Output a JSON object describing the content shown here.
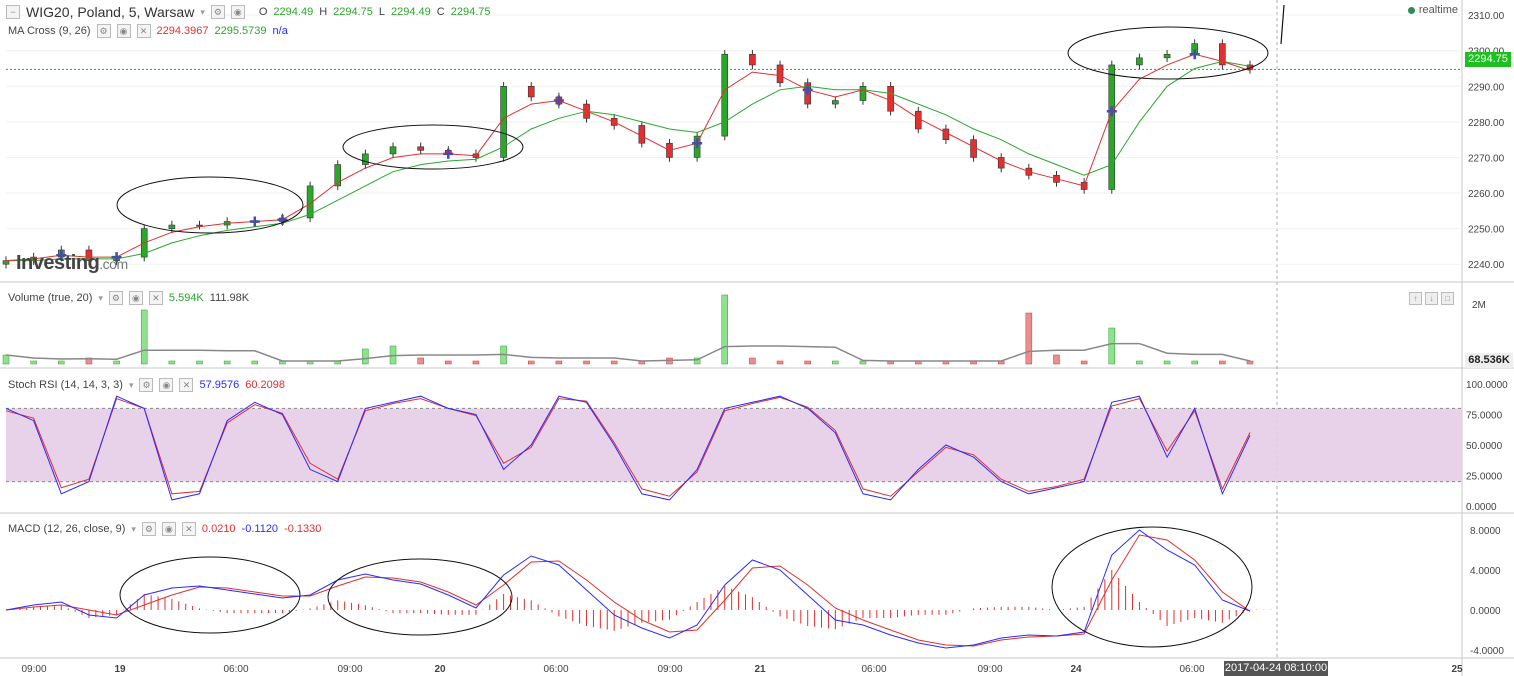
{
  "header": {
    "symbol": "WIG20, Poland, 5, Warsaw",
    "ohlc": {
      "o_label": "O",
      "o": "2294.49",
      "h_label": "H",
      "h": "2294.75",
      "l_label": "L",
      "l": "2294.49",
      "c_label": "C",
      "c": "2294.75"
    },
    "realtime": "realtime"
  },
  "indicators": {
    "ma": {
      "label": "MA Cross (9, 26)",
      "v1": "2294.3967",
      "v2": "2295.5739",
      "v3": "n/a"
    },
    "volume": {
      "label": "Volume (true, 20)",
      "v1": "5.594K",
      "v2": "111.98K"
    },
    "stoch": {
      "label": "Stoch RSI (14, 14, 3, 3)",
      "v1": "57.9576",
      "v2": "60.2098"
    },
    "macd": {
      "label": "MACD (12, 26, close, 9)",
      "v1": "0.0210",
      "v2": "-0.1120",
      "v3": "-0.1330"
    }
  },
  "logo": {
    "main": "Investing",
    "suffix": ".com"
  },
  "price_axis": {
    "ticks": [
      "2310.00",
      "2300.00",
      "2290.00",
      "2280.00",
      "2270.00",
      "2260.00",
      "2250.00",
      "2240.00"
    ],
    "current": "2294.75"
  },
  "volume_axis": {
    "ticks": [
      "2M"
    ],
    "current": "68.536K"
  },
  "stoch_axis": {
    "ticks": [
      "100.0000",
      "75.0000",
      "50.0000",
      "25.0000",
      "0.0000"
    ]
  },
  "macd_axis": {
    "ticks": [
      "8.0000",
      "4.0000",
      "0.0000",
      "-4.0000"
    ]
  },
  "time_axis": {
    "labels": [
      "09:00",
      "19",
      "06:00",
      "09:00",
      "20",
      "06:00",
      "09:00",
      "21",
      "06:00",
      "09:00",
      "24",
      "06:00",
      "25"
    ],
    "cursor": "2017-04-24 08:10:00"
  },
  "colors": {
    "up": "#2aa82a",
    "down": "#e03030",
    "ma_fast": "#e03030",
    "ma_slow": "#2aa82a",
    "stoch_k": "#2a2aff",
    "stoch_d": "#e03030",
    "macd": "#2a2aff",
    "signal": "#e03030",
    "band": "#e4cde8"
  },
  "chart_data": [
    {
      "type": "line",
      "title": "WIG20, Poland, 5, Warsaw",
      "note": "price (close) with MA Cross 9/26",
      "ylim": [
        2235,
        2312
      ],
      "series": [
        {
          "name": "close",
          "values": [
            2241,
            2242,
            2244,
            2241,
            2242,
            2250,
            2251,
            2251,
            2252,
            2252,
            2253,
            2262,
            2268,
            2271,
            2273,
            2272,
            2271,
            2270,
            2290,
            2287,
            2285,
            2281,
            2279,
            2274,
            2270,
            2276,
            2299,
            2296,
            2291,
            2285,
            2286,
            2290,
            2283,
            2278,
            2275,
            2270,
            2267,
            2265,
            2263,
            2261,
            2296,
            2298,
            2299,
            2302,
            2296,
            2294.75
          ]
        },
        {
          "name": "MA 9",
          "values": [
            2241,
            2241.5,
            2242.5,
            2242,
            2242,
            2246,
            2249,
            2250.5,
            2251.5,
            2252,
            2252.5,
            2257,
            2263,
            2267,
            2270,
            2271,
            2271,
            2270.5,
            2281,
            2285,
            2286,
            2283,
            2280,
            2276,
            2272,
            2274,
            2289,
            2294,
            2293,
            2289,
            2287,
            2289,
            2286,
            2281,
            2277,
            2273,
            2269,
            2266,
            2264,
            2262,
            2283,
            2292,
            2296,
            2299,
            2297,
            2294.4
          ]
        },
        {
          "name": "MA 26",
          "values": [
            2241,
            2241,
            2241.5,
            2241.5,
            2241.5,
            2243,
            2246,
            2248,
            2249.5,
            2250.5,
            2251.5,
            2254,
            2258,
            2262,
            2266,
            2268,
            2269,
            2269.5,
            2273,
            2278,
            2281,
            2283,
            2282,
            2280,
            2278,
            2277,
            2280,
            2285,
            2289,
            2290,
            2289,
            2289,
            2288,
            2285,
            2282,
            2278,
            2275,
            2271,
            2268,
            2265,
            2268,
            2280,
            2290,
            2295,
            2297,
            2295.6
          ]
        }
      ]
    },
    {
      "type": "bar",
      "title": "Volume (true, 20)",
      "values": [
        0.3,
        0.1,
        0.1,
        0.2,
        0.1,
        1.8,
        0.1,
        0.1,
        0.1,
        0.1,
        0.1,
        0.1,
        0.1,
        0.5,
        0.6,
        0.2,
        0.1,
        0.1,
        0.6,
        0.1,
        0.1,
        0.1,
        0.1,
        0.1,
        0.2,
        0.2,
        2.3,
        0.2,
        0.1,
        0.1,
        0.1,
        0.1,
        0.1,
        0.1,
        0.1,
        0.1,
        0.1,
        1.7,
        0.3,
        0.1,
        1.2,
        0.1,
        0.1,
        0.1,
        0.1,
        0.1
      ]
    },
    {
      "type": "line",
      "title": "Stoch RSI (14, 14, 3, 3)",
      "ylim": [
        0,
        100
      ],
      "series": [
        {
          "name": "K",
          "values": [
            80,
            70,
            10,
            20,
            90,
            80,
            5,
            10,
            70,
            85,
            75,
            30,
            20,
            80,
            85,
            90,
            80,
            75,
            30,
            50,
            90,
            85,
            50,
            10,
            5,
            30,
            80,
            85,
            90,
            80,
            60,
            10,
            5,
            30,
            50,
            40,
            20,
            10,
            15,
            20,
            85,
            90,
            40,
            80,
            10,
            57.96
          ]
        },
        {
          "name": "D",
          "values": [
            78,
            72,
            15,
            22,
            88,
            80,
            10,
            12,
            68,
            83,
            76,
            35,
            22,
            78,
            84,
            88,
            80,
            74,
            35,
            48,
            88,
            86,
            52,
            14,
            8,
            28,
            78,
            84,
            89,
            81,
            62,
            14,
            8,
            28,
            48,
            42,
            22,
            12,
            16,
            22,
            82,
            88,
            45,
            78,
            14,
            60.21
          ]
        }
      ]
    },
    {
      "type": "line",
      "title": "MACD (12, 26, close, 9)",
      "ylim": [
        -4.5,
        9
      ],
      "series": [
        {
          "name": "MACD",
          "values": [
            0,
            0.5,
            0.8,
            -0.5,
            -0.8,
            1.5,
            2.2,
            2.4,
            2.0,
            1.6,
            1.2,
            1.5,
            3.0,
            3.6,
            3.0,
            2.6,
            1.5,
            0.2,
            3.5,
            5.4,
            4.5,
            2.0,
            -0.5,
            -1.8,
            -2.8,
            -1.5,
            2.5,
            5.0,
            4.0,
            1.5,
            -1.0,
            -1.5,
            -2.5,
            -3.3,
            -3.8,
            -3.5,
            -2.8,
            -2.5,
            -2.6,
            -2.2,
            5.5,
            8.0,
            6.0,
            4.5,
            1.0,
            -0.112
          ]
        },
        {
          "name": "Signal",
          "values": [
            0,
            0.3,
            0.5,
            0,
            -0.5,
            0.5,
            1.5,
            2.3,
            2.2,
            1.8,
            1.4,
            1.4,
            2.4,
            3.3,
            3.2,
            2.8,
            1.8,
            0.5,
            2.5,
            4.8,
            4.9,
            3.0,
            0.8,
            -1.0,
            -2.2,
            -2.0,
            1.0,
            4.2,
            4.4,
            2.5,
            0.2,
            -1.0,
            -2.0,
            -3.0,
            -3.5,
            -3.6,
            -3.0,
            -2.7,
            -2.6,
            -2.4,
            3.0,
            7.5,
            7.0,
            5.0,
            1.8,
            -0.133
          ]
        }
      ]
    }
  ]
}
